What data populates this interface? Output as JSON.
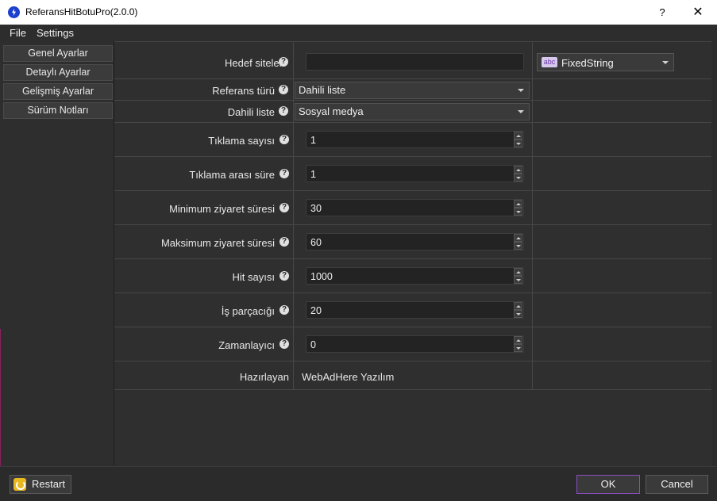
{
  "window": {
    "title": "ReferansHitBotuPro(2.0.0)",
    "help_label": "?",
    "close_label": "✕"
  },
  "menu": {
    "items": [
      "File",
      "Settings"
    ]
  },
  "sidebar": {
    "items": [
      "Genel Ayarlar",
      "Detaylı Ayarlar",
      "Gelişmiş Ayarlar",
      "Sürüm Notları"
    ]
  },
  "form": {
    "help_glyph": "?",
    "hedef_siteler": {
      "label": "Hedef siteler",
      "value": "",
      "type_badge": "abc",
      "type_value": "FixedString"
    },
    "referans_turu": {
      "label": "Referans türü",
      "value": "Dahili liste"
    },
    "dahili_liste": {
      "label": "Dahili liste",
      "value": "Sosyal medya"
    },
    "spinners": [
      {
        "label": "Tıklama sayısı",
        "value": "1"
      },
      {
        "label": "Tıklama arası süre",
        "value": "1"
      },
      {
        "label": "Minimum ziyaret süresi",
        "value": "30"
      },
      {
        "label": "Maksimum ziyaret süresi",
        "value": "60"
      },
      {
        "label": "Hit sayısı",
        "value": "1000"
      },
      {
        "label": "İş parçacığı",
        "value": "20"
      },
      {
        "label": "Zamanlayıcı",
        "value": "0"
      }
    ],
    "hazirlayan": {
      "label": "Hazırlayan",
      "value": "WebAdHere Yazılım"
    }
  },
  "footer": {
    "restart_label": "Restart",
    "ok_label": "OK",
    "cancel_label": "Cancel"
  },
  "colors": {
    "ok_border": "#8a4ec0",
    "restart_icon": "#e8b820",
    "app_icon": "#1b3fcf",
    "type_badge_bg": "#d8c8ee"
  }
}
